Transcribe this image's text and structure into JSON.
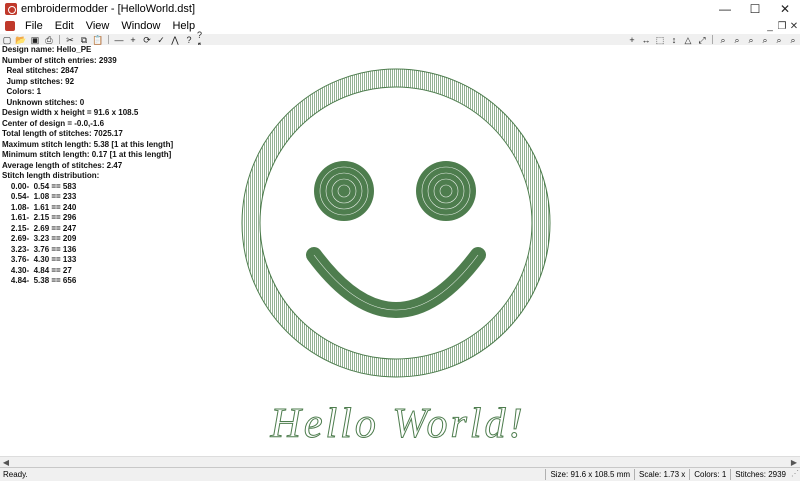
{
  "window": {
    "title": "embroidermodder - [HelloWorld.dst]"
  },
  "window_controls": {
    "minimize": "—",
    "maximize": "☐",
    "close": "✕"
  },
  "menu": [
    "File",
    "Edit",
    "View",
    "Window",
    "Help"
  ],
  "mdi_controls": {
    "minimize": "_",
    "restore": "❐",
    "close": "✕"
  },
  "toolbar": {
    "new": "▢",
    "open": "📂",
    "save": "▣",
    "print": "⎙",
    "cut": "✂",
    "copy": "⧉",
    "paste": "📋",
    "minus": "—",
    "plus": "+",
    "refresh": "⟳",
    "check": "✓",
    "tri": "⋀",
    "help": "?",
    "whatsthis": "?↖",
    "right_tools": [
      "+",
      "↔",
      "⬚",
      "↕",
      "△",
      "⤢",
      "⌕",
      "⌕",
      "⌕",
      "⌕",
      "⌕",
      "⌕"
    ]
  },
  "info": {
    "design_name": "Design name: Hello_PE",
    "stitch_entries": "Number of stitch entries: 2939",
    "real_stitches": "  Real stitches: 2847",
    "jump_stitches": "  Jump stitches: 92",
    "colors": "  Colors: 1",
    "unknown_stitches": "  Unknown stitches: 0",
    "dimensions": "Design width x height = 91.6 x 108.5",
    "center": "Center of design = -0.0,-1.6",
    "total_length": "Total length of stitches: 7025.17",
    "max_length": "Maximum stitch length: 5.38 [1 at this length]",
    "min_length": "Minimum stitch length: 0.17 [1 at this length]",
    "avg_length": "Average length of stitches: 2.47",
    "distribution_title": "Stitch length distribution:",
    "distribution": [
      "    0.00-  0.54 == 583",
      "    0.54-  1.08 == 233",
      "    1.08-  1.61 == 240",
      "    1.61-  2.15 == 296",
      "    2.15-  2.69 == 247",
      "    2.69-  3.23 == 209",
      "    3.23-  3.76 == 136",
      "    3.76-  4.30 == 133",
      "    4.30-  4.84 == 27",
      "    4.84-  5.38 == 656"
    ]
  },
  "design": {
    "text": "Hello World!",
    "thread_color": "#4e7d4e"
  },
  "scrollbar": {
    "left": "◀",
    "right": "▶"
  },
  "status": {
    "ready": "Ready.",
    "size": "Size: 91.6 x 108.5 mm",
    "scale": "Scale: 1.73 x",
    "colors": "Colors: 1",
    "stitches": "Stitches: 2939",
    "grip": "⋰"
  }
}
